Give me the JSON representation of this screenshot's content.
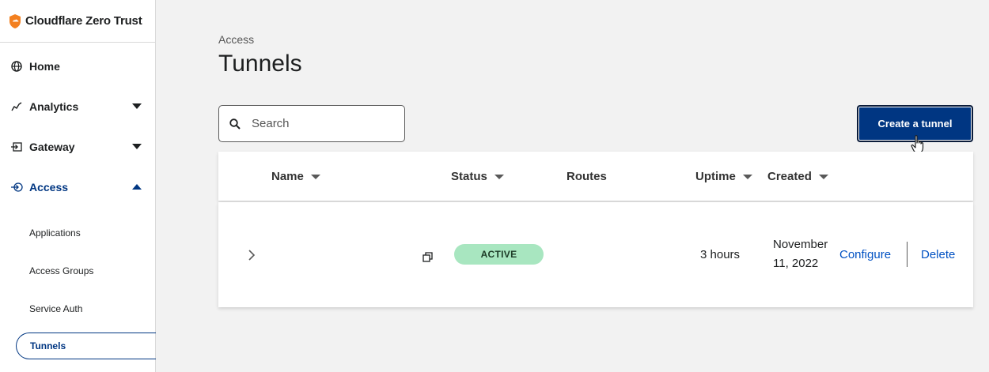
{
  "brand": {
    "name": "Cloudflare Zero Trust",
    "accent": "#f38020"
  },
  "sidebar": {
    "items": [
      {
        "label": "Home",
        "icon": "globe-icon"
      },
      {
        "label": "Analytics",
        "icon": "analytics-icon"
      },
      {
        "label": "Gateway",
        "icon": "gateway-icon"
      },
      {
        "label": "Access",
        "icon": "access-icon"
      }
    ],
    "access_subitems": [
      {
        "label": "Applications"
      },
      {
        "label": "Access Groups"
      },
      {
        "label": "Service Auth"
      },
      {
        "label": "Tunnels"
      }
    ]
  },
  "page": {
    "breadcrumb": "Access",
    "title": "Tunnels"
  },
  "search": {
    "placeholder": "Search"
  },
  "toolbar": {
    "create_label": "Create a tunnel"
  },
  "table": {
    "columns": [
      "Name",
      "Status",
      "Routes",
      "Uptime",
      "Created"
    ],
    "rows": [
      {
        "name": "",
        "status": "ACTIVE",
        "routes": "",
        "uptime": "3 hours",
        "created": "November 11, 2022",
        "actions": [
          "Configure",
          "Delete"
        ]
      }
    ]
  },
  "colors": {
    "primary": "#003682",
    "link": "#0051c3",
    "active_badge": "#a8e6c0"
  }
}
